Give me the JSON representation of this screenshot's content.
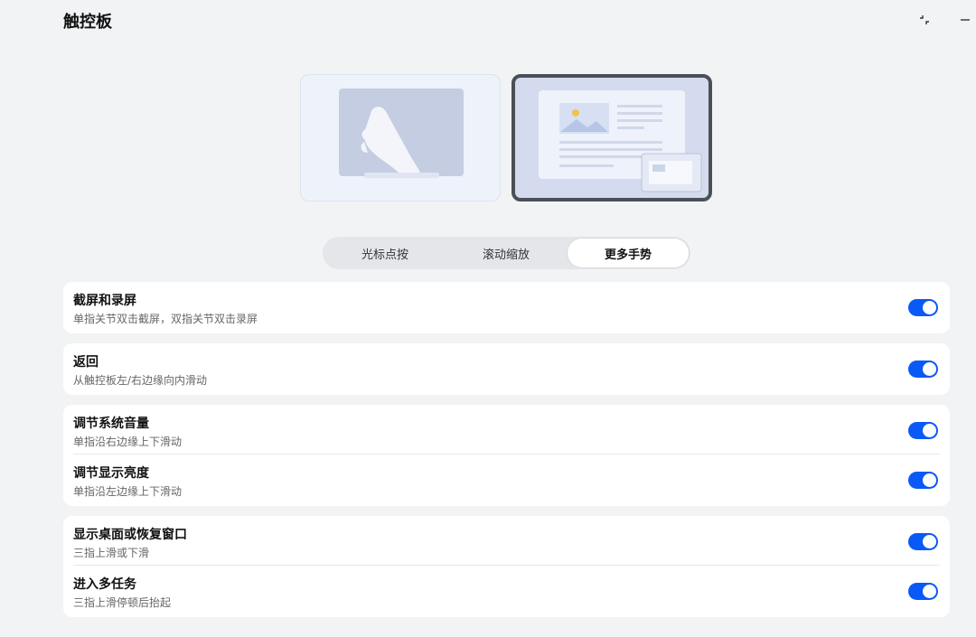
{
  "window": {
    "title": "触控板",
    "controls": [
      "restore-icon",
      "minimize-icon"
    ]
  },
  "tabs": [
    {
      "label": "光标点按",
      "active": false
    },
    {
      "label": "滚动缩放",
      "active": false
    },
    {
      "label": "更多手势",
      "active": true
    }
  ],
  "settings": {
    "screenshot": {
      "title": "截屏和录屏",
      "subtitle": "单指关节双击截屏，双指关节双击录屏",
      "enabled": true
    },
    "back": {
      "title": "返回",
      "subtitle": "从触控板左/右边缘向内滑动",
      "enabled": true
    },
    "volume": {
      "title": "调节系统音量",
      "subtitle": "单指沿右边缘上下滑动",
      "enabled": true
    },
    "brightness": {
      "title": "调节显示亮度",
      "subtitle": "单指沿左边缘上下滑动",
      "enabled": true
    },
    "desktop": {
      "title": "显示桌面或恢复窗口",
      "subtitle": "三指上滑或下滑",
      "enabled": true
    },
    "multitask": {
      "title": "进入多任务",
      "subtitle": "三指上滑停顿后抬起",
      "enabled": true
    }
  },
  "colors": {
    "accent": "#0a59f7",
    "background": "#f1f3f5",
    "card": "#ffffff"
  }
}
